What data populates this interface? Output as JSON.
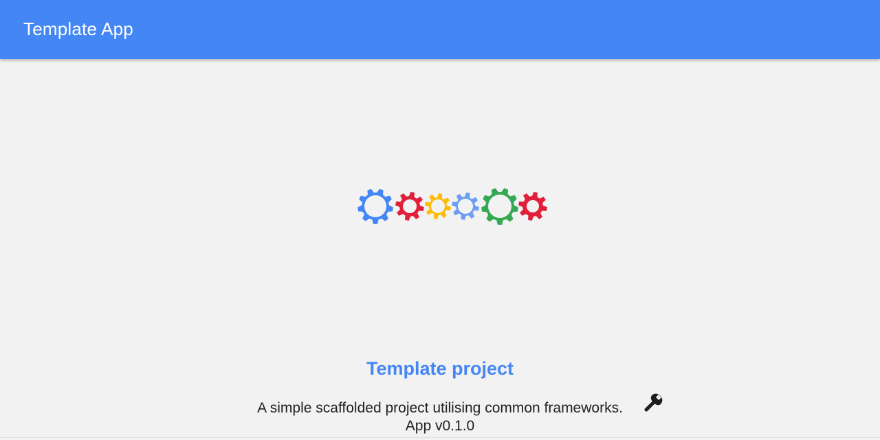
{
  "app_bar": {
    "title": "Template App",
    "color": "#4486f4"
  },
  "hero": {
    "icon": "gears-logo",
    "gear_colors": [
      "#4486f4",
      "#e0203a",
      "#fbbc05",
      "#6a9ff5",
      "#34a853",
      "#e0203a"
    ]
  },
  "project": {
    "title": "Template project",
    "description": "A simple scaffolded project utilising common frameworks.",
    "description_icon": "wrench-icon",
    "version": "App v0.1.0"
  }
}
